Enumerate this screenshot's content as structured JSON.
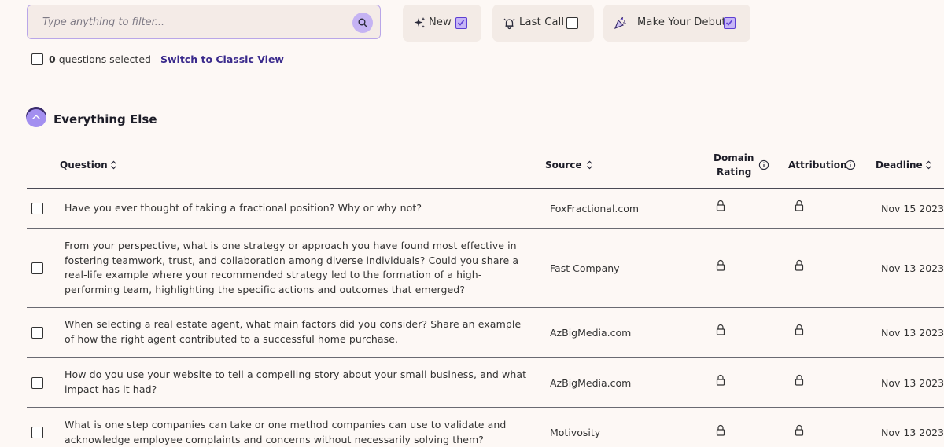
{
  "search": {
    "placeholder": "Type anything to filter...",
    "value": ""
  },
  "filters": [
    {
      "label": "New",
      "icon": "sparkles-icon",
      "checked": true
    },
    {
      "label": "Last Call",
      "icon": "alarm-bell-icon",
      "checked": false
    },
    {
      "label": "Make Your Debut",
      "icon": "party-popper-icon",
      "checked": true
    }
  ],
  "selection": {
    "count": "0",
    "suffix": "questions selected",
    "classic_view_link": "Switch to Classic View"
  },
  "section": {
    "title": "Everything Else"
  },
  "table": {
    "headers": {
      "question": "Question",
      "source": "Source",
      "domain_rating_line1": "Domain",
      "domain_rating_line2": "Rating",
      "attribution": "Attribution",
      "deadline": "Deadline"
    },
    "rows": [
      {
        "question": "Have you ever thought of taking a fractional position? Why or why not?",
        "source": "FoxFractional.com",
        "deadline": "Nov 15 2023"
      },
      {
        "question": "From your perspective, what is one strategy or approach you have found most effective in fostering teamwork, trust, and collaboration among diverse individuals? Could you share a real-life example where your recommended strategy led to the formation of a high-performing team, highlighting the specific actions and outcomes that emerged?",
        "source": "Fast Company",
        "deadline": "Nov 13 2023"
      },
      {
        "question": "When selecting a real estate agent, what main factors did you consider? Share an example of how the right agent contributed to a successful home purchase.",
        "source": "AzBigMedia.com",
        "deadline": "Nov 13 2023"
      },
      {
        "question": "How do you use your website to tell a compelling story about your small business, and what impact has it had?",
        "source": "AzBigMedia.com",
        "deadline": "Nov 13 2023"
      },
      {
        "question": "What is one step companies can take or one method companies can use to validate and acknowledge employee complaints and concerns without necessarily solving them?",
        "source": "Motivosity",
        "deadline": "Nov 13 2023"
      }
    ]
  },
  "colors": {
    "accent": "#5d3fd3",
    "accent_light": "#c6b6f6",
    "background": "#fdf8f5",
    "chip": "#f3ebe6"
  }
}
